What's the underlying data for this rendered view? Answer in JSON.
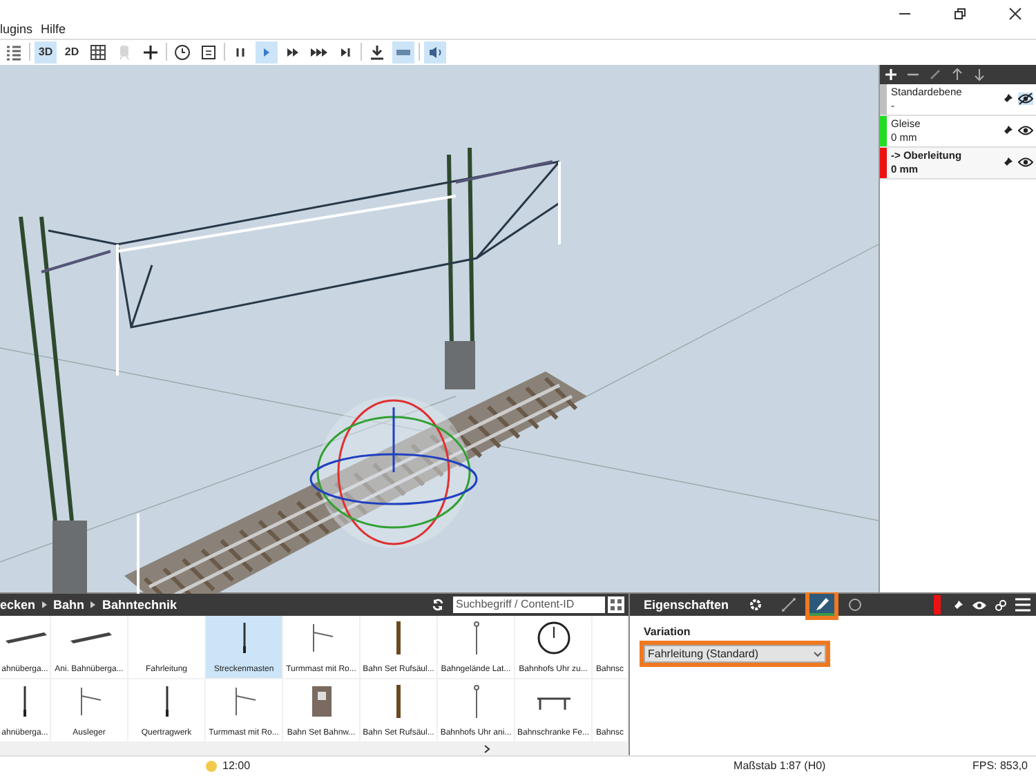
{
  "menu": [
    "lugins",
    "Hilfe"
  ],
  "window_controls": [
    {
      "kind": "minimize"
    },
    {
      "kind": "restore"
    },
    {
      "kind": "close"
    }
  ],
  "toolbar": [
    [
      {
        "kind": "list",
        "selected": false
      }
    ],
    [
      {
        "kind": "text",
        "label": "3D",
        "selected": true
      },
      {
        "kind": "text",
        "label": "2D",
        "selected": false
      },
      {
        "kind": "grid",
        "selected": false
      },
      {
        "kind": "train",
        "selected": false,
        "disabled": true
      },
      {
        "kind": "plus",
        "selected": false
      }
    ],
    [
      {
        "kind": "clock",
        "selected": false
      },
      {
        "kind": "calendar",
        "selected": false
      }
    ],
    [
      {
        "kind": "pause",
        "selected": false
      },
      {
        "kind": "play",
        "selected": true
      },
      {
        "kind": "fast",
        "selected": false
      },
      {
        "kind": "faster",
        "selected": false
      },
      {
        "kind": "skip",
        "selected": false
      }
    ],
    [
      {
        "kind": "download",
        "selected": false
      },
      {
        "kind": "bar",
        "selected": true
      }
    ],
    [
      {
        "kind": "speaker",
        "selected": true
      }
    ]
  ],
  "layers": {
    "tools": [
      {
        "kind": "plus"
      },
      {
        "kind": "minus"
      },
      {
        "kind": "edit"
      },
      {
        "kind": "up"
      },
      {
        "kind": "down"
      }
    ],
    "items": [
      {
        "name": "Standardebene",
        "value": "-",
        "color": "#c0c0c0",
        "selected": false,
        "visible": false
      },
      {
        "name": "Gleise",
        "value": "0 mm",
        "color": "#22dd22",
        "selected": false,
        "visible": true
      },
      {
        "name": "-> Oberleitung",
        "value": "0 mm",
        "color": "#ee1111",
        "selected": true,
        "visible": true
      }
    ]
  },
  "catalog": {
    "breadcrumb": [
      "ecken",
      "Bahn",
      "Bahntechnik"
    ],
    "search": {
      "placeholder": "Suchbegriff / Content-ID"
    },
    "rows": [
      [
        {
          "label": "ahnüberga...",
          "kind": "slab",
          "selected": false
        },
        {
          "label": "Ani. Bahnüberga...",
          "kind": "slab",
          "selected": false
        },
        {
          "label": "Fahrleitung",
          "kind": "empty",
          "selected": false
        },
        {
          "label": "Streckenmasten",
          "kind": "pole",
          "selected": true
        },
        {
          "label": "Turmmast mit Ro...",
          "kind": "arm",
          "selected": false
        },
        {
          "label": "Bahn Set Rufsäul...",
          "kind": "post",
          "selected": false
        },
        {
          "label": "Bahngelände Lat...",
          "kind": "lamp",
          "selected": false
        },
        {
          "label": "Bahnhofs Uhr zu...",
          "kind": "clock",
          "selected": false
        },
        {
          "label": "Bahnsc",
          "kind": "empty",
          "selected": false
        }
      ],
      [
        {
          "label": "ahnüberga...",
          "kind": "pole",
          "selected": false
        },
        {
          "label": "Ausleger",
          "kind": "arm",
          "selected": false
        },
        {
          "label": "Quertragwerk",
          "kind": "pole",
          "selected": false
        },
        {
          "label": "Turmmast mit Ro...",
          "kind": "arm",
          "selected": false
        },
        {
          "label": "Bahn Set Bahnw...",
          "kind": "cabinet",
          "selected": false
        },
        {
          "label": "Bahn Set Rufsäul...",
          "kind": "post",
          "selected": false
        },
        {
          "label": "Bahnhofs Uhr ani...",
          "kind": "lamp",
          "selected": false
        },
        {
          "label": "Bahnschranke Fe...",
          "kind": "barrier",
          "selected": false
        },
        {
          "label": "Bahnsc",
          "kind": "empty",
          "selected": false
        }
      ]
    ]
  },
  "properties": {
    "title": "Eigenschaften",
    "tabs": [
      {
        "kind": "gear",
        "selected": false,
        "highlighted": false
      },
      {
        "kind": "graph",
        "selected": false,
        "highlighted": false
      },
      {
        "kind": "brush",
        "selected": true,
        "highlighted": true
      },
      {
        "kind": "circle",
        "selected": false,
        "highlighted": false
      }
    ],
    "variation": {
      "label": "Variation",
      "value": "Fahrleitung (Standard)",
      "highlighted": true
    }
  },
  "status_bar": {
    "time": "12:00",
    "scale": "Maßstab 1:87 (H0)",
    "fps": "FPS: 853,0"
  }
}
